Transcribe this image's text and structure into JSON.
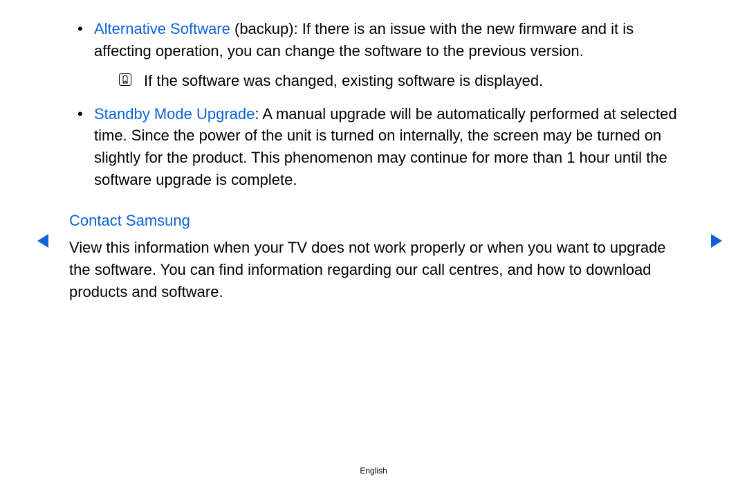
{
  "bullets": [
    {
      "term": "Alternative Software",
      "rest": " (backup): If there is an issue with the new firmware and it is affecting operation, you can change the software to the previous version.",
      "note": "If the software was changed, existing software is displayed."
    },
    {
      "term": "Standby Mode Upgrade",
      "rest": ": A manual upgrade will be automatically performed at selected time. Since the power of the unit is turned on internally, the screen may be turned on slightly for the product. This phenomenon may continue for more than 1 hour until the software upgrade is complete."
    }
  ],
  "section": {
    "title": "Contact Samsung",
    "body": "View this information when your TV does not work properly or when you want to upgrade the software. You can find information regarding our call centres, and how to download products and software."
  },
  "footer": "English",
  "icons": {
    "note": "note-pencil-icon",
    "prev": "triangle-left",
    "next": "triangle-right"
  }
}
